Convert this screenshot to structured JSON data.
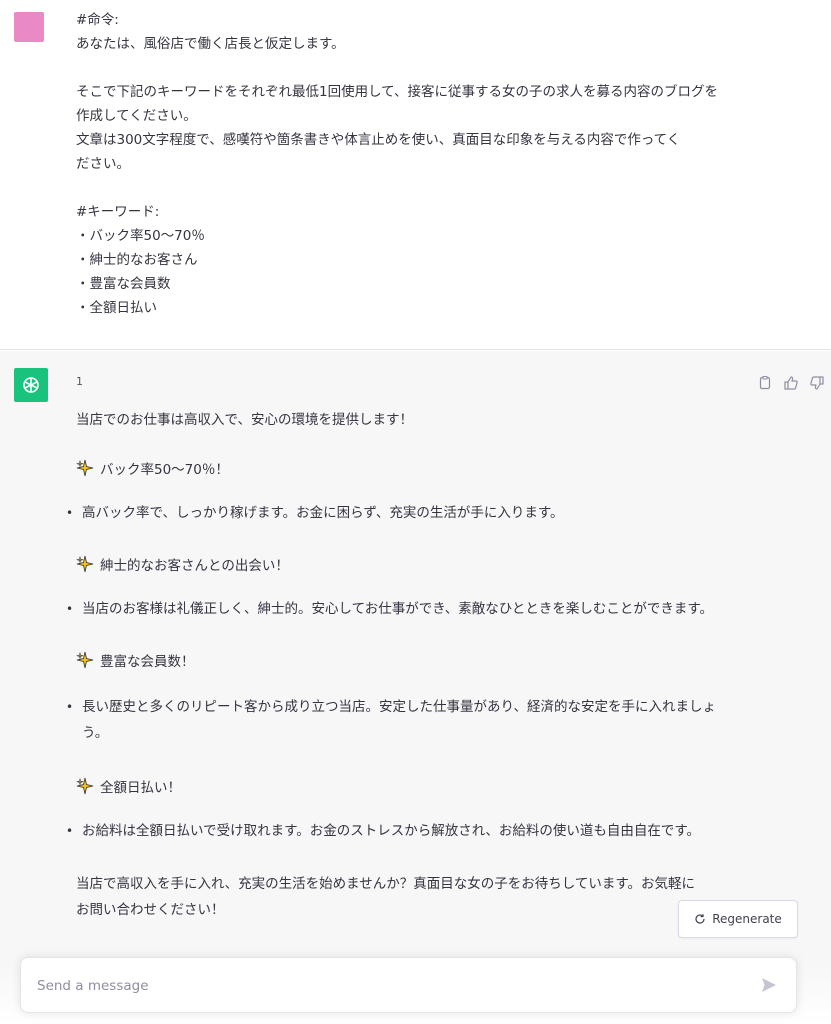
{
  "user_message": {
    "avatar_label": "",
    "lines": [
      "#命令:",
      "あなたは、風俗店で働く店長と仮定します。",
      "",
      "そこで下記のキーワードをそれぞれ最低1回使用して、接客に従事する女の子の求人を募る内容のブログを",
      "作成してください。",
      "文章は300文字程度で、感嘆符や箇条書きや体言止めを使い、真面目な印象を与える内容で作ってく",
      "ださい。",
      "",
      "#キーワード:",
      "・バック率50～70％",
      "・紳士的なお客さん",
      "・豊富な会員数",
      "・全額日払い"
    ]
  },
  "assistant_message": {
    "counter": "1",
    "intro": "当店でのお仕事は高収入で、安心の環境を提供します！",
    "sections": [
      {
        "heading": "バック率50～70％！",
        "bullet_lines": [
          "高バック率で、しっかり稼げます。お金に困らず、充実の生活が手に入ります。"
        ]
      },
      {
        "heading": "紳士的なお客さんとの出会い！",
        "bullet_lines": [
          "当店のお客様は礼儀正しく、紳士的。安心してお仕事ができ、素敵なひとときを楽しむことができます。"
        ]
      },
      {
        "heading": "豊富な会員数！",
        "bullet_lines": [
          "長い歴史と多くのリピート客から成り立つ当店。安定した仕事量があり、経済的な安定を手に入れましょ",
          "う。"
        ]
      },
      {
        "heading": "全額日払い！",
        "bullet_lines": [
          "お給料は全額日払いで受け取れます。お金のストレスから解放され、お給料の使い道も自由自在です。"
        ]
      }
    ],
    "closing_lines": [
      "当店で高収入を手に入れ、充実の生活を始めませんか？真面目な女の子をお待ちしています。お気軽に",
      "お問い合わせください！"
    ]
  },
  "actions": {
    "copy_icon": "clipboard-icon",
    "like_icon": "thumbs-up-icon",
    "dislike_icon": "thumbs-down-icon"
  },
  "regenerate": {
    "label": "Regenerate"
  },
  "composer": {
    "placeholder": "Send a message",
    "send_icon": "paper-plane-icon"
  },
  "colors": {
    "user_avatar": "#e98ac4",
    "bot_avatar": "#19c37d",
    "assistant_bg": "#f7f7f8",
    "text": "#343541"
  }
}
